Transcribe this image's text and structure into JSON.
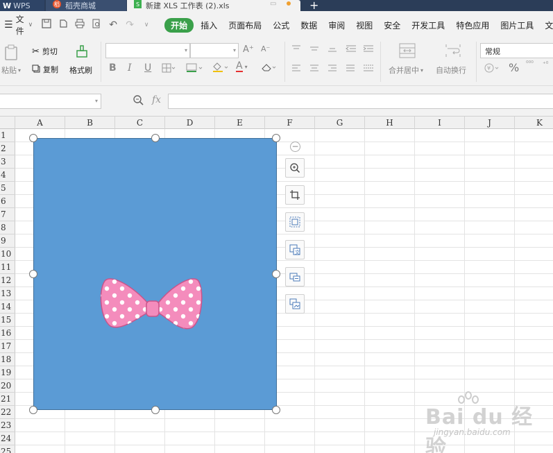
{
  "tabs": {
    "wps_logo": "W",
    "wps_label": "WPS",
    "store_icon": "稻",
    "store_label": "稻壳商城",
    "doc_icon": "S",
    "doc_label": "新建 XLS 工作表 (2).xls",
    "new_tab": "+"
  },
  "menubar": {
    "file_label": "文件",
    "items": [
      "开始",
      "插入",
      "页面布局",
      "公式",
      "数据",
      "审阅",
      "视图",
      "安全",
      "开发工具",
      "特色应用",
      "图片工具",
      "文"
    ]
  },
  "ribbon": {
    "paste_label": "粘贴",
    "cut_label": "剪切",
    "copy_label": "复制",
    "format_painter_label": "格式刷",
    "merge_center_label": "合并居中",
    "wrap_text_label": "自动换行",
    "number_format_value": "常规",
    "bold": "B",
    "italic": "I",
    "underline": "U",
    "font_grow": "A⁺",
    "font_shrink": "A⁻",
    "font_color_letter": "A",
    "percent": "%"
  },
  "formulabar": {
    "fx_label": "fx",
    "namebox_value": "",
    "formula_value": ""
  },
  "grid": {
    "columns": [
      "A",
      "B",
      "C",
      "D",
      "E",
      "F",
      "G",
      "H",
      "I",
      "J",
      "K"
    ],
    "rows": [
      "1",
      "2",
      "3",
      "4",
      "5",
      "6",
      "7",
      "8",
      "9",
      "10",
      "11",
      "12",
      "13",
      "14",
      "15",
      "16",
      "17",
      "18",
      "19",
      "20",
      "21",
      "22",
      "23",
      "24",
      "25"
    ]
  },
  "picture": {
    "background_color": "#5b9bd5",
    "bow_color": "#f48cbc",
    "bow_outline": "#c9548a"
  },
  "side_toolbar": {
    "icons": [
      "zoom-in-icon",
      "crop-icon",
      "image-select-icon",
      "image-text-icon",
      "compress-image-icon",
      "replace-image-icon"
    ]
  },
  "watermark": {
    "main": "Bai du 经验",
    "sub": "jingyan.baidu.com"
  },
  "colors": {
    "accent_green": "#3aa04a",
    "titlebar": "#2b3d58"
  }
}
